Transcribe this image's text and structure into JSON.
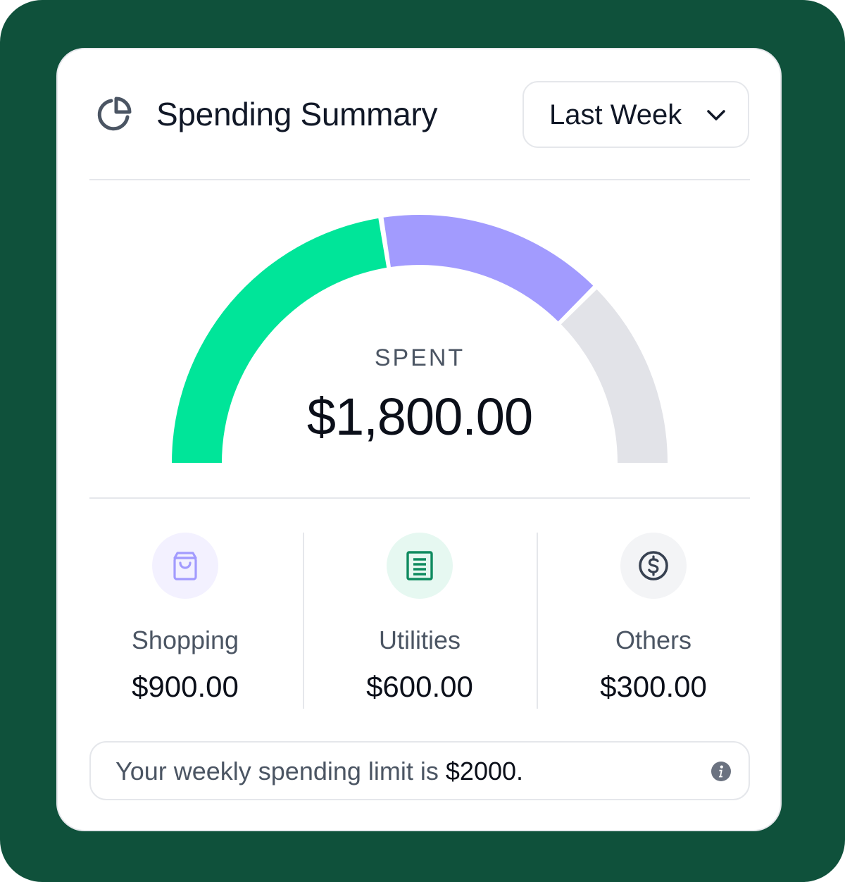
{
  "colors": {
    "background": "#0f513b",
    "shopping": "#00e599",
    "utilities": "#a29bfe",
    "remaining": "#e2e3e8",
    "shopping_icon_bg": "#f3f1ff",
    "shopping_icon": "#a29bfe",
    "utilities_icon_bg": "#e6f8f1",
    "utilities_icon": "#0e8a5f",
    "others_icon_bg": "#f3f4f6",
    "others_icon": "#374151"
  },
  "header": {
    "icon": "pie-chart-icon",
    "title": "Spending Summary",
    "period": {
      "selected": "Last Week",
      "icon": "chevron-down-icon"
    }
  },
  "gauge": {
    "label": "SPENT",
    "total": "$1,800.00",
    "limit_value": 2000,
    "segments": [
      {
        "key": "shopping",
        "value": 900
      },
      {
        "key": "utilities",
        "value": 600
      },
      {
        "key": "others",
        "value": 300
      }
    ]
  },
  "categories": [
    {
      "name": "Shopping",
      "amount": "$900.00",
      "icon": "shopping-bag-icon"
    },
    {
      "name": "Utilities",
      "amount": "$600.00",
      "icon": "document-list-icon"
    },
    {
      "name": "Others",
      "amount": "$300.00",
      "icon": "dollar-circle-icon"
    }
  ],
  "note": {
    "text": "Your weekly spending limit is ",
    "limit": "$2000.",
    "icon": "info-icon"
  }
}
